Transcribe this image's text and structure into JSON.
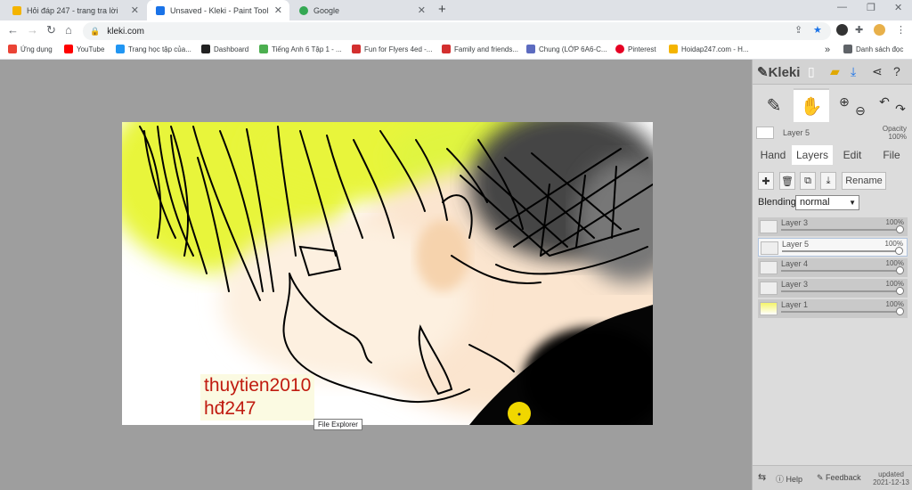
{
  "tabs": [
    {
      "title": "Hỏi đáp 247 - trang tra lời",
      "fav_color": "#f4b400",
      "active": false
    },
    {
      "title": "Unsaved - Kleki - Paint Tool",
      "fav_color": "#1a73e8",
      "active": true
    },
    {
      "title": "Google",
      "fav_color": "#34a853",
      "active": false
    }
  ],
  "address": {
    "url": "kleki.com"
  },
  "bookmarks": [
    {
      "label": "Ứng dụng",
      "color": "#ea4335"
    },
    {
      "label": "YouTube",
      "color": "#ff0000"
    },
    {
      "label": "Trang học tập của...",
      "color": "#2196f3"
    },
    {
      "label": "Dashboard",
      "color": "#222222"
    },
    {
      "label": "Tiếng Anh 6 Tập 1 - ...",
      "color": "#4caf50"
    },
    {
      "label": "Fun for Flyers 4ed -...",
      "color": "#d32f2f"
    },
    {
      "label": "Family and friends...",
      "color": "#d32f2f"
    },
    {
      "label": "Chung (LỚP 6A6-C...",
      "color": "#5c6bc0"
    },
    {
      "label": "Pinterest",
      "color": "#e60023"
    },
    {
      "label": "Hoidap247.com - H...",
      "color": "#f4b400"
    }
  ],
  "bookmarks_more": "»",
  "reading_list": "Danh sách đọc",
  "kleki": {
    "logo": "Kleki",
    "current_layer": "Layer 5",
    "opacity_label": "Opacity",
    "opacity_value": "100%",
    "tabs": [
      "Hand",
      "Layers",
      "Edit",
      "File"
    ],
    "rename": "Rename",
    "blending_label": "Blending",
    "blending_value": "normal",
    "layers": [
      {
        "name": "Layer 3",
        "opacity": "100%",
        "selected": false
      },
      {
        "name": "Layer 5",
        "opacity": "100%",
        "selected": true
      },
      {
        "name": "Layer 4",
        "opacity": "100%",
        "selected": false
      },
      {
        "name": "Layer 3",
        "opacity": "100%",
        "selected": false
      },
      {
        "name": "Layer 1",
        "opacity": "100%",
        "selected": false
      }
    ],
    "help": "Help",
    "feedback": "Feedback",
    "updated_label": "updated",
    "updated_date": "2021-12-13"
  },
  "canvas": {
    "watermark_line1": "thuytien2010",
    "watermark_line2": "hđ247"
  },
  "tooltip": "File Explorer"
}
